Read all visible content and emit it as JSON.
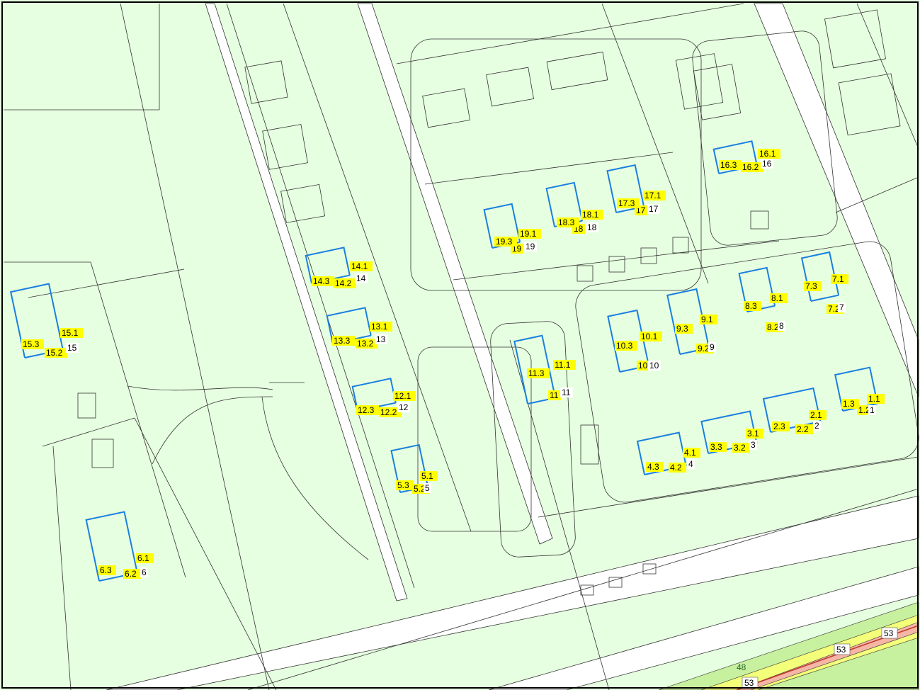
{
  "colors": {
    "background": "#e6ffe0",
    "road": "#ffffff",
    "line": "#333333",
    "building_outline": "#1a7fe0",
    "label_highlight": "#ffff00",
    "highway_green": "#c7f09f",
    "highway_yellow": "#f4ff7a",
    "highway_pink": "#f5b6a6",
    "highway_red": "#c0392b"
  },
  "buildings": [
    {
      "id": "1",
      "labels": [
        "1.1",
        "1.2",
        "1.3"
      ]
    },
    {
      "id": "2",
      "labels": [
        "2.1",
        "2.2",
        "2.3"
      ]
    },
    {
      "id": "3",
      "labels": [
        "3.1",
        "3.2",
        "3.3"
      ]
    },
    {
      "id": "4",
      "labels": [
        "4.1",
        "4.2",
        "4.3"
      ]
    },
    {
      "id": "5",
      "labels": [
        "5.1",
        "5.2",
        "5.3"
      ]
    },
    {
      "id": "6",
      "labels": [
        "6.1",
        "6.2",
        "6.3"
      ]
    },
    {
      "id": "7",
      "labels": [
        "7.1",
        "7.2",
        "7.3"
      ]
    },
    {
      "id": "8",
      "labels": [
        "8.1",
        "8.2",
        "8.3"
      ]
    },
    {
      "id": "9",
      "labels": [
        "9.1",
        "9.2",
        "9.3"
      ]
    },
    {
      "id": "10",
      "labels": [
        "10.1",
        "10",
        "10.3"
      ]
    },
    {
      "id": "11",
      "labels": [
        "11.1",
        "11",
        "11.3"
      ]
    },
    {
      "id": "12",
      "labels": [
        "12.1",
        "12.2",
        "12.3"
      ]
    },
    {
      "id": "13",
      "labels": [
        "13.1",
        "13.2",
        "13.3"
      ]
    },
    {
      "id": "14",
      "labels": [
        "14.1",
        "14.2",
        "14.3"
      ]
    },
    {
      "id": "15",
      "labels": [
        "15.1",
        "15.2",
        "15.3"
      ]
    },
    {
      "id": "16",
      "labels": [
        "16.1",
        "16.2",
        "16.3"
      ]
    },
    {
      "id": "17",
      "labels": [
        "17.1",
        "17",
        "17.3"
      ]
    },
    {
      "id": "18",
      "labels": [
        "18.1",
        "18",
        "18.3"
      ]
    },
    {
      "id": "19",
      "labels": [
        "19.1",
        "19",
        "19.3"
      ]
    }
  ],
  "road_labels": {
    "contour_48": "48",
    "contour_53_a": "53",
    "contour_53_b": "53",
    "contour_53_c": "53"
  }
}
